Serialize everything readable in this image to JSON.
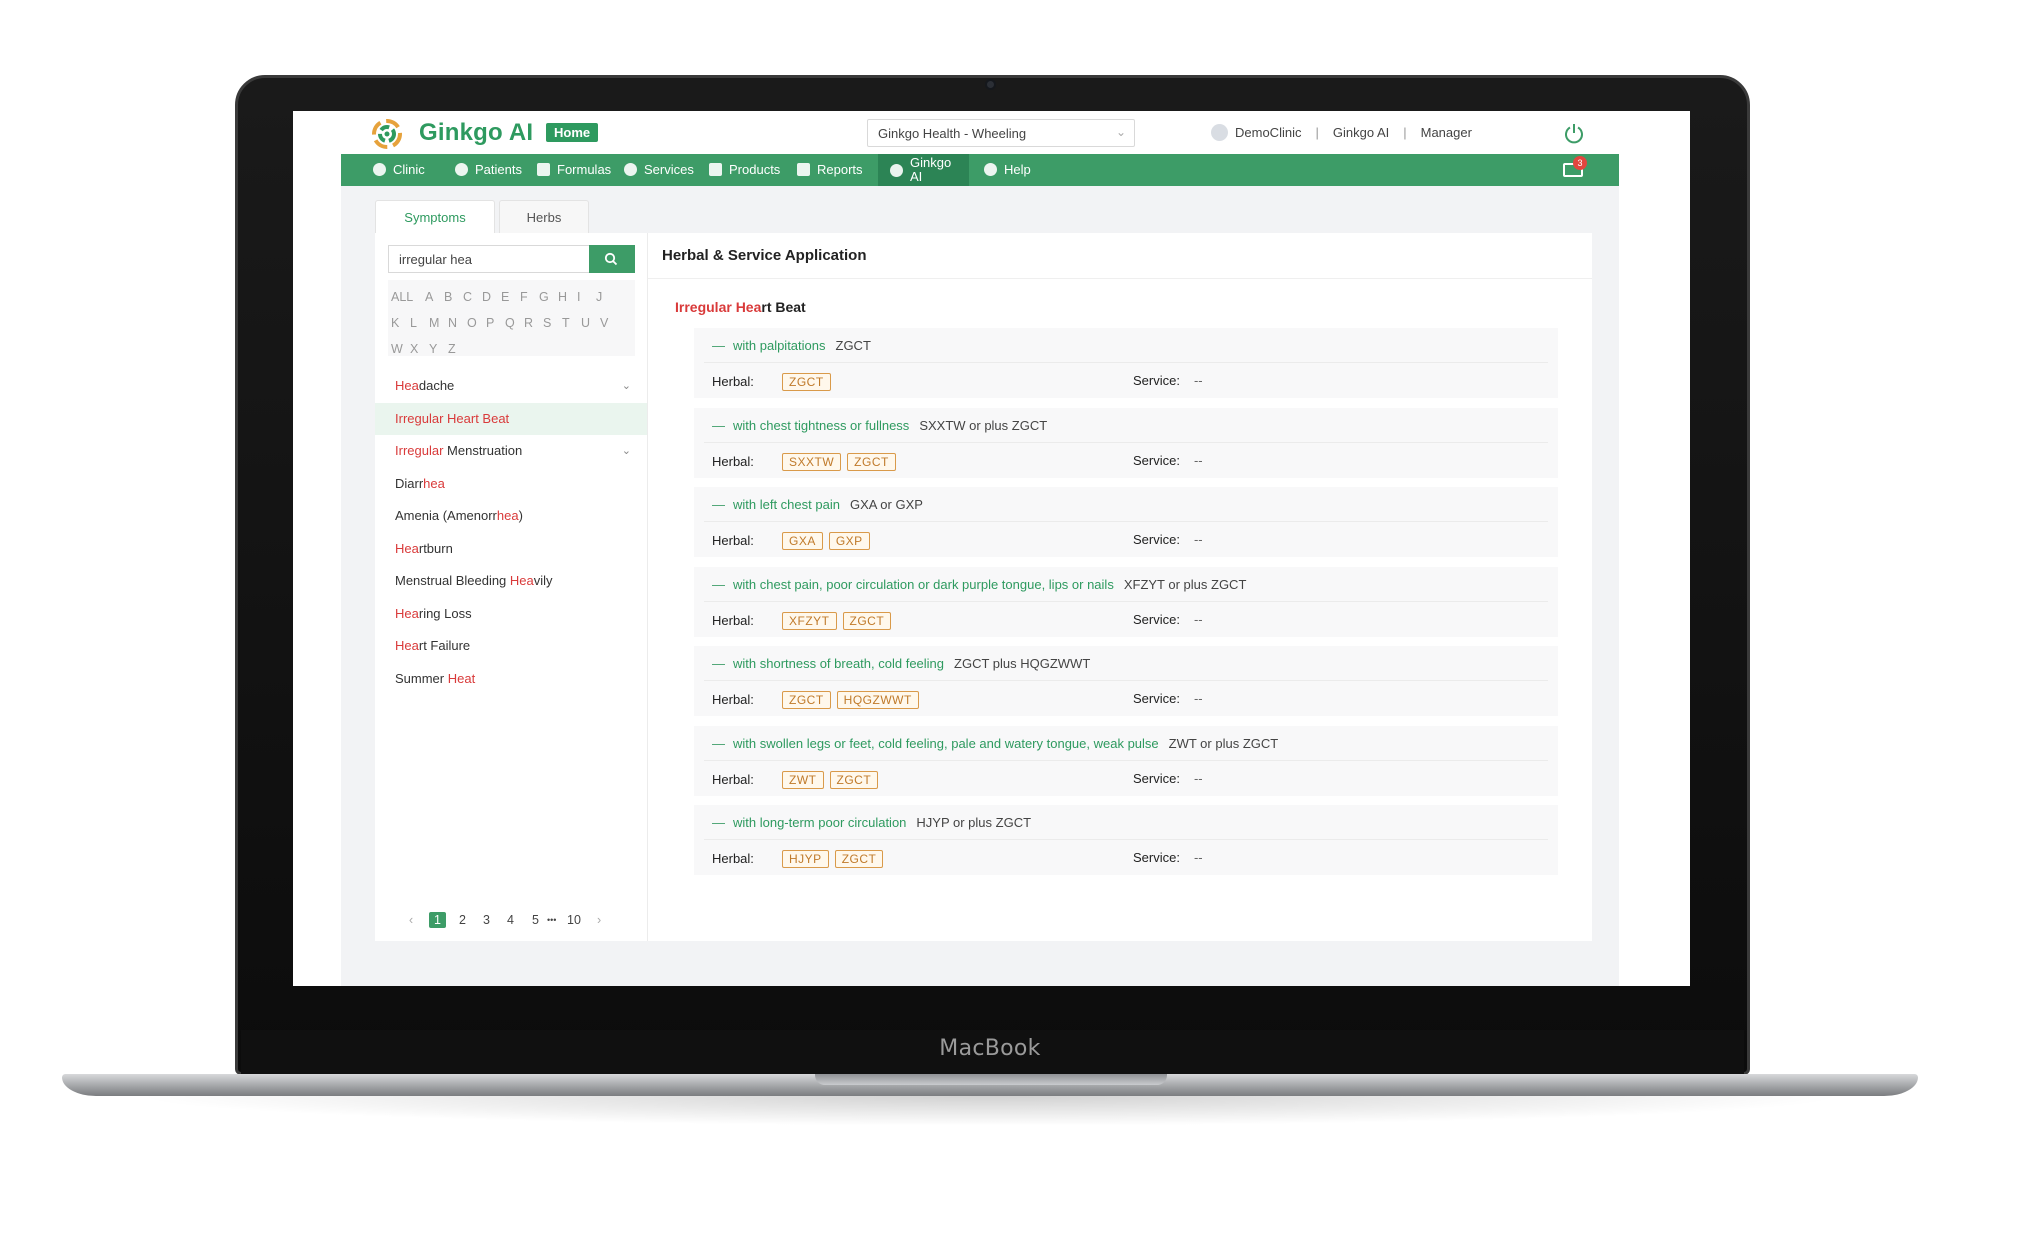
{
  "device": {
    "brand": "MacBook"
  },
  "header": {
    "logo_text": "Ginkgo AI",
    "home_label": "Home",
    "clinic_select": "Ginkgo Health - Wheeling",
    "user": {
      "clinic": "DemoClinic",
      "org": "Ginkgo AI",
      "role": "Manager"
    }
  },
  "nav": {
    "items": [
      {
        "label": "Clinic",
        "icon": "clinic-icon"
      },
      {
        "label": "Patients",
        "icon": "patients-icon"
      },
      {
        "label": "Formulas",
        "icon": "formulas-icon"
      },
      {
        "label": "Services",
        "icon": "services-icon"
      },
      {
        "label": "Products",
        "icon": "products-icon"
      },
      {
        "label": "Reports",
        "icon": "reports-icon"
      },
      {
        "label_line1": "Ginkgo",
        "label_line2": "AI",
        "icon": "ginkgo-ai-icon",
        "active": true
      },
      {
        "label": "Help",
        "icon": "help-icon"
      }
    ],
    "mail_count": "3"
  },
  "tabs": {
    "symptoms": "Symptoms",
    "herbs": "Herbs"
  },
  "search": {
    "value": "irregular hea"
  },
  "alphabet": [
    "ALL",
    "A",
    "B",
    "C",
    "D",
    "E",
    "F",
    "G",
    "H",
    "I",
    "J",
    "K",
    "L",
    "M",
    "N",
    "O",
    "P",
    "Q",
    "R",
    "S",
    "T",
    "U",
    "V",
    "W",
    "X",
    "Y",
    "Z"
  ],
  "symptoms": [
    {
      "hl": "Hea",
      "rest": "dache"
    },
    {
      "hl": "Irregular Heart Beat",
      "rest": ""
    },
    {
      "hl": "Irregular",
      "rest": " Menstruation"
    },
    {
      "pre": "Diarr",
      "hl": "hea"
    },
    {
      "pre": "Amenia (Amenorr",
      "hl": "hea",
      "post": ")"
    },
    {
      "hl": "Hea",
      "rest": "rtburn"
    },
    {
      "pre": "Menstrual Bleeding ",
      "hl": "Hea",
      "post": "vily"
    },
    {
      "hl": "Hea",
      "rest": "ring Loss"
    },
    {
      "hl": "Hea",
      "rest": "rt Failure"
    },
    {
      "pre": "Summer ",
      "hl": "Heat"
    }
  ],
  "pager": {
    "pages": [
      "1",
      "2",
      "3",
      "4",
      "5"
    ],
    "ellipsis": "•••",
    "last": "10",
    "prev": "‹",
    "next": "›"
  },
  "main": {
    "title": "Herbal & Service Application",
    "condition_hl": "Irregular Hea",
    "condition_rest": "rt Beat",
    "herbal_label": "Herbal:",
    "service_label": "Service:",
    "cards": [
      {
        "cond": "with palpitations",
        "rx": "ZGCT",
        "herbs": [
          "ZGCT"
        ],
        "service": "--"
      },
      {
        "cond": "with chest tightness or fullness",
        "rx": "SXXTW or plus ZGCT",
        "herbs": [
          "SXXTW",
          "ZGCT"
        ],
        "service": "--"
      },
      {
        "cond": "with left chest pain",
        "rx": "GXA or GXP",
        "herbs": [
          "GXA",
          "GXP"
        ],
        "service": "--"
      },
      {
        "cond": "with chest pain, poor circulation or dark purple tongue, lips or nails",
        "rx": "XFZYT or plus ZGCT",
        "herbs": [
          "XFZYT",
          "ZGCT"
        ],
        "service": "--"
      },
      {
        "cond": "with shortness of breath, cold feeling",
        "rx": "ZGCT plus HQGZWWT",
        "herbs": [
          "ZGCT",
          "HQGZWWT"
        ],
        "service": "--"
      },
      {
        "cond": "with swollen legs or feet, cold feeling, pale and watery tongue, weak pulse",
        "rx": "ZWT or plus ZGCT",
        "herbs": [
          "ZWT",
          "ZGCT"
        ],
        "service": "--"
      },
      {
        "cond": "with long-term poor circulation",
        "rx": "HJYP or plus ZGCT",
        "herbs": [
          "HJYP",
          "ZGCT"
        ],
        "service": "--"
      }
    ]
  }
}
